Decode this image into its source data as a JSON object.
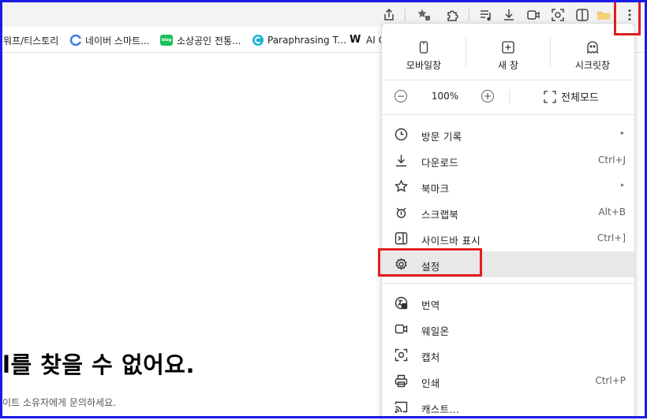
{
  "toolbar": {
    "icons": [
      "share-icon",
      "bookmark-star-icon",
      "extensions-icon",
      "reading-list-icon",
      "download-icon",
      "video-icon",
      "screenshot-icon",
      "sidebar-icon",
      "folder-icon",
      "more-icon"
    ]
  },
  "bookmarks": [
    {
      "label": "워프/티스토리",
      "icon": "none"
    },
    {
      "label": "네이버 스마트...",
      "icon": "c-logo"
    },
    {
      "label": "소상공인 전통...",
      "icon": "blog-logo"
    },
    {
      "label": "Paraphrasing T...",
      "icon": "quillbot-logo"
    },
    {
      "label": "AI C",
      "icon": "w-logo"
    }
  ],
  "page": {
    "heading": "l를 찾을 수 없어요.",
    "subtext": "이트 소유자에게 문의하세요."
  },
  "menu": {
    "top_actions": [
      {
        "label": "모바일창",
        "icon": "mobile-icon"
      },
      {
        "label": "새 창",
        "icon": "new-window-icon"
      },
      {
        "label": "시크릿창",
        "icon": "incognito-icon"
      }
    ],
    "zoom": {
      "minus": "−",
      "value": "100%",
      "plus": "+",
      "fullscreen": "전체모드"
    },
    "items": [
      {
        "label": "방문 기록",
        "shortcut": "",
        "arrow": "▸"
      },
      {
        "label": "다운로드",
        "shortcut": "Ctrl+J",
        "arrow": ""
      },
      {
        "label": "북마크",
        "shortcut": "",
        "arrow": "▸"
      },
      {
        "label": "스크랩북",
        "shortcut": "Alt+B",
        "arrow": ""
      },
      {
        "label": "사이드바 표시",
        "shortcut": "Ctrl+]",
        "arrow": ""
      },
      {
        "label": "설정",
        "shortcut": "",
        "arrow": ""
      },
      {
        "label": "번역",
        "shortcut": "",
        "arrow": ""
      },
      {
        "label": "웨일온",
        "shortcut": "",
        "arrow": ""
      },
      {
        "label": "캡처",
        "shortcut": "",
        "arrow": ""
      },
      {
        "label": "인쇄",
        "shortcut": "Ctrl+P",
        "arrow": ""
      },
      {
        "label": "캐스트...",
        "shortcut": "",
        "arrow": ""
      }
    ]
  },
  "colors": {
    "highlight": "#e01e1e",
    "frame": "#1a1ae6",
    "hover": "#e8e8e8",
    "toolbar": "#f1f3f4"
  }
}
